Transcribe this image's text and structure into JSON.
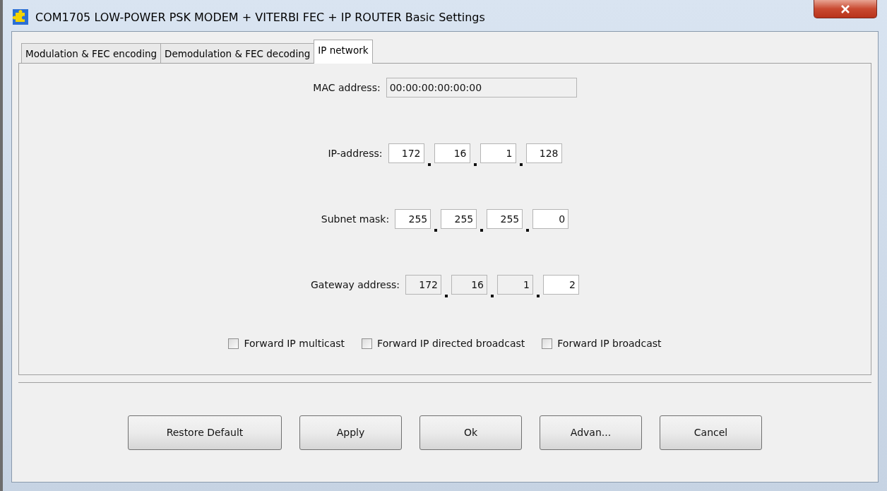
{
  "window": {
    "title": "COM1705 LOW-POWER PSK MODEM + VITERBI FEC + IP ROUTER Basic Settings"
  },
  "tabs": [
    {
      "label": "Modulation & FEC encoding",
      "selected": false
    },
    {
      "label": "Demodulation & FEC decoding",
      "selected": false
    },
    {
      "label": "IP network",
      "selected": true
    }
  ],
  "mac_address": {
    "label": "MAC address:",
    "value": "00:00:00:00:00:00",
    "disabled": true
  },
  "address_rows": [
    {
      "label": "IP-address:",
      "octets": [
        {
          "value": "172",
          "disabled": false
        },
        {
          "value": "16",
          "disabled": false
        },
        {
          "value": "1",
          "disabled": false
        },
        {
          "value": "128",
          "disabled": false
        }
      ]
    },
    {
      "label": "Subnet mask:",
      "octets": [
        {
          "value": "255",
          "disabled": false
        },
        {
          "value": "255",
          "disabled": false
        },
        {
          "value": "255",
          "disabled": false
        },
        {
          "value": "0",
          "disabled": false
        }
      ]
    },
    {
      "label": "Gateway address:",
      "octets": [
        {
          "value": "172",
          "disabled": true
        },
        {
          "value": "16",
          "disabled": true
        },
        {
          "value": "1",
          "disabled": true
        },
        {
          "value": "2",
          "disabled": false
        }
      ]
    }
  ],
  "checkboxes": [
    {
      "label": "Forward IP multicast",
      "checked": false
    },
    {
      "label": "Forward IP directed broadcast",
      "checked": false
    },
    {
      "label": "Forward IP broadcast",
      "checked": false
    }
  ],
  "buttons": [
    "Restore Default",
    "Apply",
    "Ok",
    "Advan...",
    "Cancel"
  ]
}
